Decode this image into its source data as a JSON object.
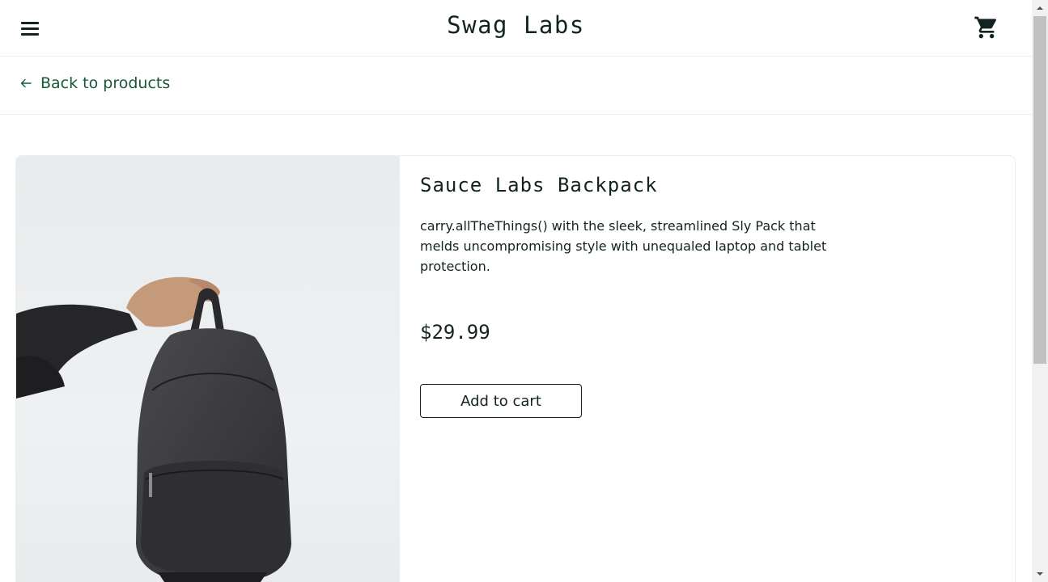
{
  "header": {
    "app_title": "Swag Labs",
    "menu_icon": "hamburger-menu-icon",
    "cart_icon": "shopping-cart-icon"
  },
  "sub_header": {
    "back_label": "Back to products",
    "back_icon": "arrow-left-icon"
  },
  "product": {
    "name": "Sauce Labs Backpack",
    "description": "carry.allTheThings() with the sleek, streamlined Sly Pack that melds uncompromising style with unequaled laptop and tablet protection.",
    "price": "$29.99",
    "add_to_cart_label": "Add to cart",
    "image_alt": "Sauce Labs Backpack"
  },
  "colors": {
    "text_primary": "#132322",
    "link_green": "#18583a",
    "border": "#ededed"
  }
}
